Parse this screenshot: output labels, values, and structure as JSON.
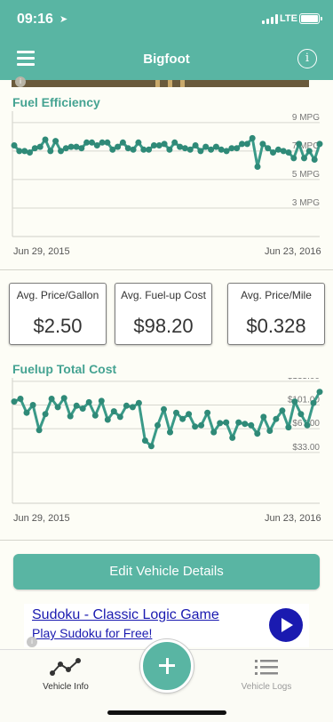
{
  "status": {
    "time": "09:16",
    "network": "LTE"
  },
  "navbar": {
    "title": "Bigfoot",
    "menu_icon": "hamburger-menu-icon",
    "info_icon": "info-icon",
    "info_glyph": "i"
  },
  "fuel_efficiency": {
    "title": "Fuel Efficiency",
    "start_date": "Jun 29, 2015",
    "end_date": "Jun 23, 2016"
  },
  "stats": [
    {
      "label": "Avg. Price/Gallon",
      "value": "$2.50"
    },
    {
      "label": "Avg. Fuel-up Cost",
      "value": "$98.20"
    },
    {
      "label": "Avg. Price/Mile",
      "value": "$0.328"
    }
  ],
  "fuelup_cost": {
    "title": "Fuelup Total Cost",
    "start_date": "Jun 29, 2015",
    "end_date": "Jun 23, 2016"
  },
  "edit_button": {
    "label": "Edit Vehicle Details"
  },
  "ad": {
    "title": "Sudoku - Classic Logic Game",
    "subtitle": "Play Sudoku for Free!",
    "play_icon": "play-icon"
  },
  "tabbar": {
    "vehicle_info": {
      "label": "Vehicle Info",
      "icon": "line-graph-icon"
    },
    "add": {
      "icon": "plus-icon"
    },
    "vehicle_logs": {
      "label": "Vehicle Logs",
      "icon": "list-icon"
    }
  },
  "colors": {
    "accent": "#59b5a3",
    "title_green": "#45a392",
    "line": "#3a9a88",
    "ad_blue": "#1a1ab0"
  },
  "chart_data": [
    {
      "type": "line",
      "title": "Fuel Efficiency",
      "ylabel": "MPG",
      "yticks": [
        3,
        5,
        7,
        9
      ],
      "ytick_labels": [
        "3 MPG",
        "5 MPG",
        "7 MPG",
        "9 MPG"
      ],
      "ylim": [
        1,
        9.8
      ],
      "x_start": "Jun 29, 2015",
      "x_end": "Jun 23, 2016",
      "values": [
        7.4,
        7.0,
        7.0,
        6.9,
        7.2,
        7.3,
        7.8,
        7.0,
        7.7,
        7.0,
        7.2,
        7.3,
        7.3,
        7.2,
        7.6,
        7.6,
        7.4,
        7.6,
        7.6,
        7.1,
        7.3,
        7.6,
        7.2,
        7.1,
        7.6,
        7.1,
        7.1,
        7.4,
        7.4,
        7.5,
        7.1,
        7.6,
        7.3,
        7.2,
        7.1,
        7.4,
        7.0,
        7.3,
        7.1,
        7.3,
        7.1,
        7.0,
        7.2,
        7.2,
        7.5,
        7.5,
        7.9,
        5.9,
        7.5,
        7.2,
        6.9,
        7.1,
        7.0,
        6.9,
        6.5,
        7.5,
        6.5,
        7.0,
        6.4,
        7.5
      ]
    },
    {
      "type": "line",
      "title": "Fuelup Total Cost",
      "ylabel": "$",
      "yticks": [
        33,
        67,
        101,
        135
      ],
      "ytick_labels": [
        "$33.00",
        "$67.00",
        "$101.00",
        "$135.00"
      ],
      "ylim": [
        -40,
        140
      ],
      "x_start": "Jun 29, 2015",
      "x_end": "Jun 23, 2016",
      "values": [
        106,
        110,
        90,
        101,
        65,
        88,
        110,
        98,
        111,
        85,
        100,
        96,
        105,
        86,
        107,
        80,
        92,
        84,
        100,
        98,
        104,
        50,
        42,
        72,
        95,
        62,
        90,
        81,
        88,
        70,
        72,
        90,
        62,
        75,
        76,
        54,
        76,
        74,
        72,
        60,
        84,
        64,
        81,
        93,
        69,
        106,
        88,
        72,
        104,
        120
      ]
    }
  ]
}
